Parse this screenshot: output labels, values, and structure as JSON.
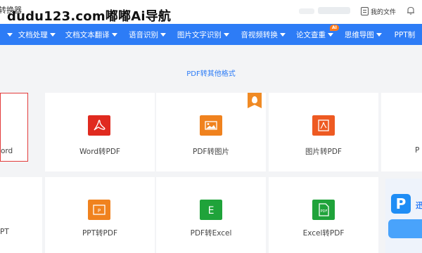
{
  "header": {
    "brand_fragment": "转换器",
    "watermark": "dudu123.com嘟嘟Ai导航",
    "my_files_label": "我的文件"
  },
  "nav": {
    "items": [
      {
        "label": "文档处理"
      },
      {
        "label": "文档文本翻译"
      },
      {
        "label": "语音识别"
      },
      {
        "label": "图片文字识别"
      },
      {
        "label": "音视频转换"
      },
      {
        "label": "论文查重",
        "badge": "AI"
      },
      {
        "label": "思维导图"
      },
      {
        "label": "PPT制"
      }
    ]
  },
  "main": {
    "section_title": "PDF转其他格式",
    "row1": [
      {
        "label": "ord",
        "icon": "word-icon",
        "hot": true,
        "selected": true
      },
      {
        "label": "Word转PDF",
        "icon": "pdf-icon",
        "hot": false
      },
      {
        "label": "PDF转图片",
        "icon": "image-icon",
        "hot": true
      },
      {
        "label": "图片转PDF",
        "icon": "pdf-image-icon",
        "hot": false
      },
      {
        "label": "P",
        "icon": "",
        "hot": false
      }
    ],
    "row2": [
      {
        "label": "PT",
        "icon": "",
        "hot": false
      },
      {
        "label": "PPT转PDF",
        "icon": "ppt-icon",
        "hot": false
      },
      {
        "label": "PDF转Excel",
        "icon": "excel-icon",
        "hot": false
      },
      {
        "label": "Excel转PDF",
        "icon": "pdf-doc-icon",
        "hot": false
      }
    ]
  },
  "promo": {
    "tail_text": "迅"
  },
  "colors": {
    "nav_bg": "#2d7cf6",
    "accent": "#2d7cf6",
    "pdf_red": "#e02a1f",
    "orange": "#f0821e",
    "excel_green": "#1fa33a",
    "selected_border": "#e23b3b"
  }
}
